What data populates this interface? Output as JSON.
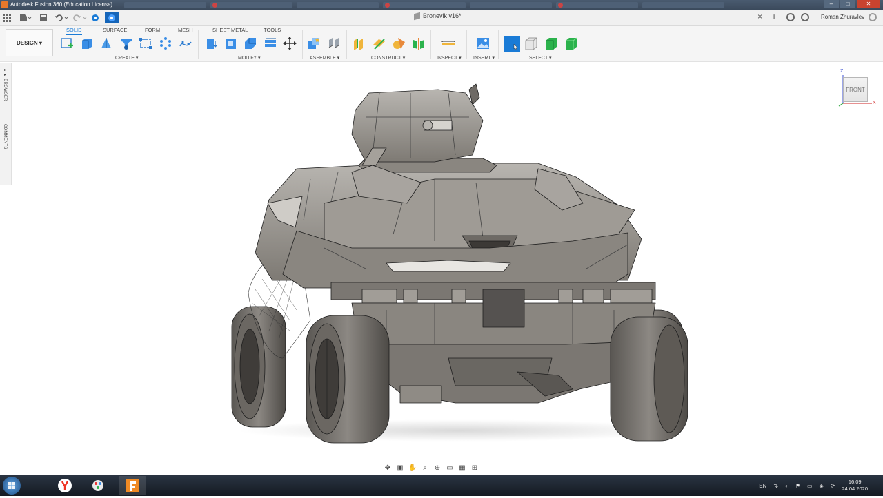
{
  "os_window": {
    "title": "Autodesk Fusion 360 (Education License)",
    "controls": [
      "–",
      "□",
      "✕"
    ]
  },
  "topbar": {
    "document_title": "Bronevik v16*",
    "user_name": "Roman Zhuravlev",
    "icons": [
      "grid-icon",
      "file-icon",
      "save-icon",
      "undo-icon",
      "redo-icon",
      "job-status-icon",
      "data-panel-icon",
      "close-tab-icon",
      "new-tab-icon",
      "extensions-icon",
      "job-status-circle-icon",
      "help-icon"
    ]
  },
  "ribbon": {
    "workspace": "DESIGN",
    "tabs": [
      "SOLID",
      "SURFACE",
      "FORM",
      "MESH",
      "SHEET METAL",
      "TOOLS"
    ],
    "active_tab": "SOLID",
    "groups": [
      "CREATE",
      "MODIFY",
      "ASSEMBLE",
      "CONSTRUCT",
      "INSPECT",
      "INSERT",
      "SELECT"
    ]
  },
  "left_panel": {
    "browser_label": "BROWSER",
    "comments_label": "COMMENTS"
  },
  "viewcube": {
    "face": "FRONT",
    "axis_z": "Z",
    "axis_x": "X"
  },
  "taskbar": {
    "language": "EN",
    "time": "16:09",
    "date": "24.04.2020"
  },
  "colors": {
    "accent": "#1a7bd6",
    "model_fill": "#8f8b85",
    "model_dark": "#5e5b57"
  }
}
